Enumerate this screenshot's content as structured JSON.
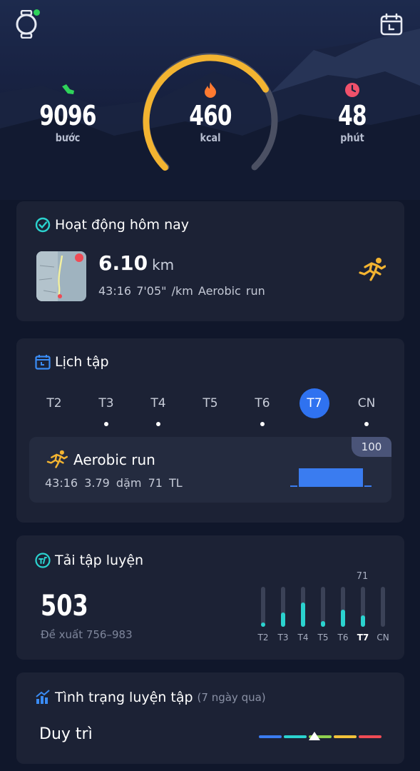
{
  "header": {
    "steps": {
      "value": "9096",
      "unit": "bước",
      "icon": "footprint-icon",
      "color": "#2fd35a"
    },
    "calories": {
      "value": "460",
      "unit": "kcal",
      "icon": "flame-icon",
      "color": "#ff7a30",
      "progress": 0.72
    },
    "minutes": {
      "value": "48",
      "unit": "phút",
      "icon": "clock-icon",
      "color": "#f0516b"
    }
  },
  "today": {
    "title": "Hoạt động hôm nay",
    "distance": "6.10",
    "distance_unit": "km",
    "duration": "43:16",
    "pace": "7'05\" /km",
    "type": "Aerobic run"
  },
  "schedule": {
    "title": "Lịch tập",
    "days": [
      {
        "label": "T2",
        "dot": false,
        "selected": false
      },
      {
        "label": "T3",
        "dot": true,
        "selected": false
      },
      {
        "label": "T4",
        "dot": true,
        "selected": false
      },
      {
        "label": "T5",
        "dot": false,
        "selected": false
      },
      {
        "label": "T6",
        "dot": true,
        "selected": false
      },
      {
        "label": "T7",
        "dot": false,
        "selected": true
      },
      {
        "label": "CN",
        "dot": true,
        "selected": false
      }
    ],
    "workout": {
      "badge": "100",
      "title": "Aerobic run",
      "duration": "43:16",
      "distance": "3.79 dặm",
      "load": "71 TL"
    }
  },
  "load": {
    "title": "Tải tập luyện",
    "value": "503",
    "suggestion": "Đề xuất 756–983",
    "current_value": "71",
    "days": [
      {
        "label": "T2",
        "level": 0.1
      },
      {
        "label": "T3",
        "level": 0.35
      },
      {
        "label": "T4",
        "level": 0.6
      },
      {
        "label": "T5",
        "level": 0.15
      },
      {
        "label": "T6",
        "level": 0.42
      },
      {
        "label": "T7",
        "level": 0.28
      },
      {
        "label": "CN",
        "level": 0
      }
    ]
  },
  "status": {
    "title": "Tình trạng luyện tập",
    "period": "(7 ngày qua)",
    "value": "Duy trì",
    "scale_colors": [
      "#3a7cf0",
      "#2bd3cf",
      "#8fd14f",
      "#f2c23a",
      "#ef4b55"
    ]
  }
}
